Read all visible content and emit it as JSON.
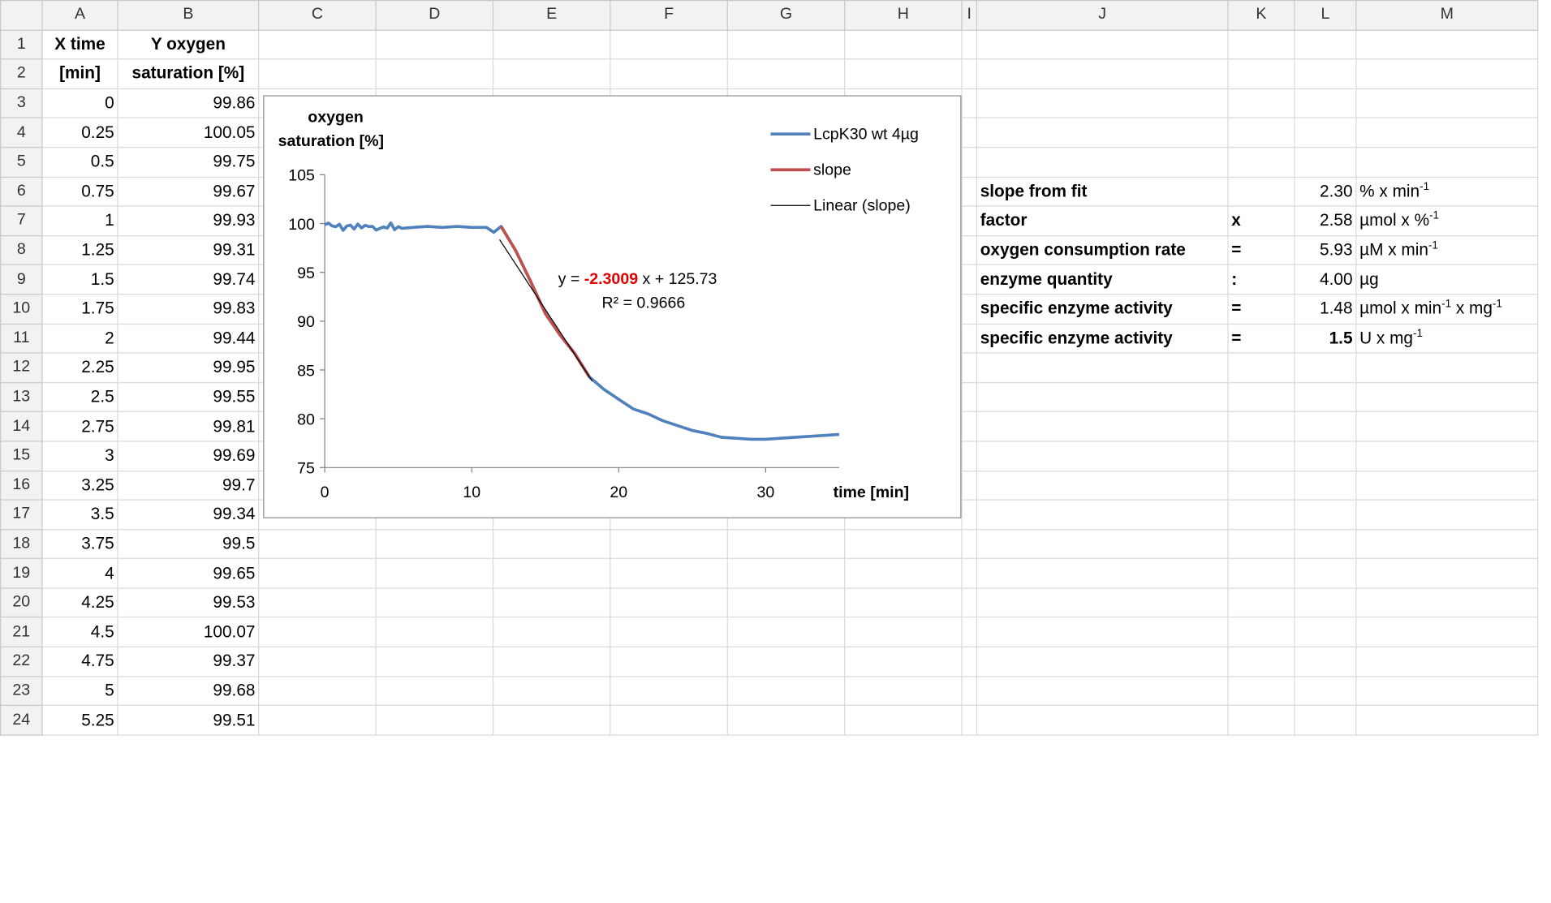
{
  "columns": [
    "A",
    "B",
    "C",
    "D",
    "E",
    "F",
    "G",
    "H",
    "I",
    "J",
    "K",
    "L",
    "M"
  ],
  "header_row1": {
    "a": "X time",
    "b": "Y oxygen"
  },
  "header_row2": {
    "a": "[min]",
    "b": "saturation [%]"
  },
  "data": [
    {
      "x": "0",
      "y": "99.86"
    },
    {
      "x": "0.25",
      "y": "100.05"
    },
    {
      "x": "0.5",
      "y": "99.75"
    },
    {
      "x": "0.75",
      "y": "99.67"
    },
    {
      "x": "1",
      "y": "99.93"
    },
    {
      "x": "1.25",
      "y": "99.31"
    },
    {
      "x": "1.5",
      "y": "99.74"
    },
    {
      "x": "1.75",
      "y": "99.83"
    },
    {
      "x": "2",
      "y": "99.44"
    },
    {
      "x": "2.25",
      "y": "99.95"
    },
    {
      "x": "2.5",
      "y": "99.55"
    },
    {
      "x": "2.75",
      "y": "99.81"
    },
    {
      "x": "3",
      "y": "99.69"
    },
    {
      "x": "3.25",
      "y": "99.7"
    },
    {
      "x": "3.5",
      "y": "99.34"
    },
    {
      "x": "3.75",
      "y": "99.5"
    },
    {
      "x": "4",
      "y": "99.65"
    },
    {
      "x": "4.25",
      "y": "99.53"
    },
    {
      "x": "4.5",
      "y": "100.07"
    },
    {
      "x": "4.75",
      "y": "99.37"
    },
    {
      "x": "5",
      "y": "99.68"
    },
    {
      "x": "5.25",
      "y": "99.51"
    }
  ],
  "results": [
    {
      "label": "slope from fit",
      "op": "",
      "value": "2.30",
      "unit": "% x min",
      "sup": "-1",
      "value_red": true,
      "value_bold": false
    },
    {
      "label": "factor",
      "op": "x",
      "value": "2.58",
      "unit": "µmol x %",
      "sup": "-1",
      "value_red": false,
      "value_bold": false
    },
    {
      "label": "oxygen consumption rate",
      "op": "=",
      "value": "5.93",
      "unit": "µM x min",
      "sup": "-1",
      "value_red": false,
      "value_bold": false
    },
    {
      "label": "enzyme quantity",
      "op": ":",
      "value": "4.00",
      "unit": "µg",
      "sup": "",
      "value_red": false,
      "value_bold": false
    },
    {
      "label": "specific enzyme activity",
      "op": "=",
      "value": "1.48",
      "unit": "µmol x min",
      "sup": "-1",
      "unit2": " x mg",
      "sup2": "-1",
      "value_red": false,
      "value_bold": false
    },
    {
      "label": "specific enzyme activity",
      "op": "=",
      "value": "1.5",
      "unit": "U x mg",
      "sup": "-1",
      "value_red": false,
      "value_bold": true
    }
  ],
  "chart_data": {
    "type": "line",
    "ylabel_line1": "oxygen",
    "ylabel_line2": "saturation [%]",
    "xlabel": "time [min]",
    "xlim": [
      0,
      35
    ],
    "ylim": [
      75,
      105
    ],
    "xticks": [
      0,
      10,
      20,
      30
    ],
    "yticks": [
      75,
      80,
      85,
      90,
      95,
      100,
      105
    ],
    "legend_position": "top-right",
    "colors": {
      "measured": "#4f81bd",
      "slope": "#c0504d",
      "fit": "#000000",
      "eq_coef": "#e00000"
    },
    "equation": {
      "prefix": "y = ",
      "coef": "-2.3009",
      "suffix": " x + 125.73",
      "r2": "R² = 0.9666"
    },
    "series": [
      {
        "name": "LcpK30 wt 4µg",
        "x": [
          0,
          0.25,
          0.5,
          0.75,
          1,
          1.25,
          1.5,
          1.75,
          2,
          2.25,
          2.5,
          2.75,
          3,
          3.25,
          3.5,
          3.75,
          4,
          4.25,
          4.5,
          4.75,
          5,
          5.25,
          6,
          7,
          8,
          9,
          10,
          11,
          11.5,
          12,
          13,
          14,
          15,
          16,
          17,
          18,
          19,
          20,
          21,
          22,
          23,
          24,
          25,
          26,
          27,
          28,
          29,
          30,
          31,
          32,
          33,
          34,
          35
        ],
        "y": [
          99.86,
          100.05,
          99.75,
          99.67,
          99.93,
          99.31,
          99.74,
          99.83,
          99.44,
          99.95,
          99.55,
          99.81,
          99.69,
          99.7,
          99.34,
          99.5,
          99.65,
          99.53,
          100.07,
          99.37,
          99.68,
          99.51,
          99.6,
          99.7,
          99.6,
          99.7,
          99.6,
          99.6,
          99.1,
          99.7,
          97.2,
          94.1,
          90.8,
          88.6,
          86.7,
          84.3,
          83.0,
          82.0,
          81.0,
          80.5,
          79.8,
          79.3,
          78.8,
          78.5,
          78.1,
          78.0,
          77.9,
          77.9,
          78.0,
          78.1,
          78.2,
          78.3,
          78.4
        ]
      },
      {
        "name": "slope",
        "x": [
          12,
          13,
          14,
          15,
          16,
          17,
          18
        ],
        "y": [
          99.7,
          97.2,
          94.1,
          90.8,
          88.6,
          86.7,
          84.3
        ]
      },
      {
        "name": "Linear (slope)",
        "x": [
          11.9,
          18.2
        ],
        "y": [
          98.35,
          83.85
        ]
      }
    ]
  }
}
